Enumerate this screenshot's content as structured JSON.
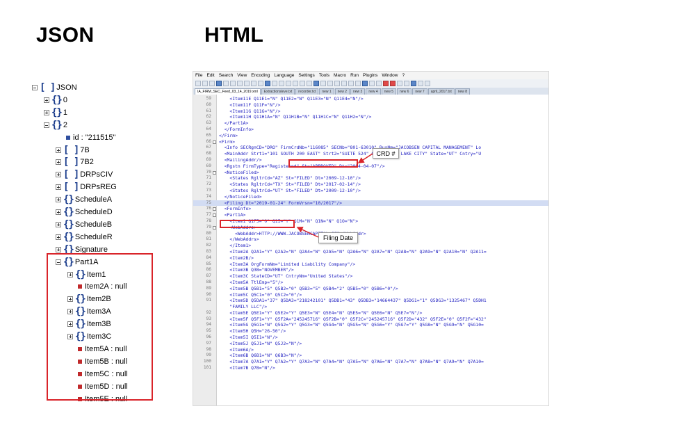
{
  "headings": {
    "left": "JSON",
    "right": "HTML"
  },
  "tree": [
    {
      "label": "JSON",
      "icon": "array",
      "level": 0,
      "expander": "minus"
    },
    {
      "label": "0",
      "icon": "object",
      "level": 1,
      "expander": "plus"
    },
    {
      "label": "1",
      "icon": "object",
      "level": 1,
      "expander": "plus"
    },
    {
      "label": "2",
      "icon": "object",
      "level": 1,
      "expander": "minus"
    },
    {
      "label": "id : \"211515\"",
      "icon": "leaf-blue",
      "level": 2,
      "expander": "none"
    },
    {
      "label": "7B",
      "icon": "array",
      "level": 2,
      "expander": "plus"
    },
    {
      "label": "7B2",
      "icon": "array",
      "level": 2,
      "expander": "plus"
    },
    {
      "label": "DRPsCIV",
      "icon": "array",
      "level": 2,
      "expander": "plus"
    },
    {
      "label": "DRPsREG",
      "icon": "array",
      "level": 2,
      "expander": "plus"
    },
    {
      "label": "ScheduleA",
      "icon": "object",
      "level": 2,
      "expander": "plus"
    },
    {
      "label": "ScheduleD",
      "icon": "object",
      "level": 2,
      "expander": "plus"
    },
    {
      "label": "ScheduleB",
      "icon": "object",
      "level": 2,
      "expander": "plus"
    },
    {
      "label": "ScheduleR",
      "icon": "object",
      "level": 2,
      "expander": "plus"
    },
    {
      "label": "Signature",
      "icon": "object",
      "level": 2,
      "expander": "plus"
    },
    {
      "label": "Part1A",
      "icon": "object",
      "level": 2,
      "expander": "minus"
    },
    {
      "label": "Item1",
      "icon": "object",
      "level": 3,
      "expander": "plus"
    },
    {
      "label": "Item2A : null",
      "icon": "leaf-red",
      "level": 3,
      "expander": "none"
    },
    {
      "label": "Item2B",
      "icon": "object",
      "level": 3,
      "expander": "plus"
    },
    {
      "label": "Item3A",
      "icon": "object",
      "level": 3,
      "expander": "plus"
    },
    {
      "label": "Item3B",
      "icon": "object",
      "level": 3,
      "expander": "plus"
    },
    {
      "label": "Item3C",
      "icon": "object",
      "level": 3,
      "expander": "plus"
    },
    {
      "label": "Item5A : null",
      "icon": "leaf-red",
      "level": 3,
      "expander": "none"
    },
    {
      "label": "Item5B : null",
      "icon": "leaf-red",
      "level": 3,
      "expander": "none"
    },
    {
      "label": "Item5C : null",
      "icon": "leaf-red",
      "level": 3,
      "expander": "none"
    },
    {
      "label": "Item5D : null",
      "icon": "leaf-red",
      "level": 3,
      "expander": "none"
    },
    {
      "label": "Item5E : null",
      "icon": "leaf-red",
      "level": 3,
      "expander": "none"
    }
  ],
  "editor": {
    "menu": [
      "File",
      "Edit",
      "Search",
      "View",
      "Encoding",
      "Language",
      "Settings",
      "Tools",
      "Macro",
      "Run",
      "Plugins",
      "Window",
      "?"
    ],
    "tabs": [
      "IA_FIRM_SEC_Feed_03_14_2019.xml",
      "Extractionsleve.txt",
      "recorder.txt",
      "new 1",
      "new 2",
      "new 3",
      "new 4",
      "new 5",
      "new 6",
      "new 7",
      "april_2017.txt",
      "new 8"
    ],
    "lines": [
      {
        "n": "59",
        "t": "    <Item11E Q11E1=\"N\" Q11E2=\"N\" Q11E3=\"N\" Q11E4=\"N\"/>"
      },
      {
        "n": "60",
        "t": "    <Item11F Q11F=\"N\"/>"
      },
      {
        "n": "61",
        "t": "    <Item11G Q11G=\"N\"/>"
      },
      {
        "n": "62",
        "t": "    <Item11H Q11H1A=\"N\" Q11H1B=\"N\" Q11H1C=\"N\" Q11H2=\"N\"/>"
      },
      {
        "n": "63",
        "t": "  </Part1A>"
      },
      {
        "n": "64",
        "t": "  </FormInfo>"
      },
      {
        "n": "65",
        "t": "</Firm>"
      },
      {
        "n": "66",
        "t": "<Firm>",
        "fold": true
      },
      {
        "n": "67",
        "t": "  <Info SECRgnCD=\"DRO\" FirmCrdNb=\"116085\" SECNb=\"801-63010\" BusNm=\"JACOBSEN CAPITAL MANAGEMENT\" Lo"
      },
      {
        "n": "68",
        "t": "  <MainAddr Strt1=\"101 SOUTH 200 EAST\" Strt2=\"SUITE 524\" City=\"SALT LAKE CITY\" State=\"UT\" Cntry=\"U"
      },
      {
        "n": "69",
        "t": "  <MailingAddr/>"
      },
      {
        "n": "69",
        "t": "  <Rgstn FirmType=\"Registered\" St=\"APPROVED\" Dt=\"2004-04-07\"/>"
      },
      {
        "n": "70",
        "t": "  <NoticeFiled>",
        "fold": true
      },
      {
        "n": "71",
        "t": "    <States RgltrCd=\"AZ\" St=\"FILED\" Dt=\"2009-12-10\"/>"
      },
      {
        "n": "72",
        "t": "    <States RgltrCd=\"TX\" St=\"FILED\" Dt=\"2017-02-14\"/>"
      },
      {
        "n": "73",
        "t": "    <States RgltrCd=\"UT\" St=\"FILED\" Dt=\"2009-12-10\"/>"
      },
      {
        "n": "74",
        "t": "  </NoticeFiled>"
      },
      {
        "n": "75",
        "t": "  <Filing Dt=\"2019-01-24\" FormVrsn=\"10/2017\"/>",
        "sel": true
      },
      {
        "n": "76",
        "t": "  <FormInfo>",
        "fold": true
      },
      {
        "n": "77",
        "t": "  <Part1A>",
        "fold": true
      },
      {
        "n": "78",
        "t": "    <Item1 Q1F5=\"0\" Q1I=\"Y\" Q1M=\"N\" Q1N=\"N\" Q1O=\"N\">"
      },
      {
        "n": "79",
        "t": "    <WebAddrs>",
        "fold": true
      },
      {
        "n": "80",
        "t": "      <WebAddr>HTTP://WWW.JACOBSENCAPITAL.COM</WebAddr>"
      },
      {
        "n": "81",
        "t": "    </WebAddrs>"
      },
      {
        "n": "82",
        "t": "    </Item1>"
      },
      {
        "n": "83",
        "t": "    <Item2A Q2A1=\"Y\" Q2A2=\"N\" Q2A4=\"N\" Q2A5=\"N\" Q2A6=\"N\" Q2A7=\"N\" Q2A8=\"N\" Q2A9=\"N\" Q2A10=\"N\" Q2A11="
      },
      {
        "n": "84",
        "t": "    <Item2B/>"
      },
      {
        "n": "85",
        "t": "    <Item3A OrgFormNm=\"Limited Liability Company\"/>"
      },
      {
        "n": "86",
        "t": "    <Item3B Q3B=\"NOVEMBER\"/>"
      },
      {
        "n": "87",
        "t": "    <Item3C StateCD=\"UT\" CntryNm=\"United States\"/>"
      },
      {
        "n": "88",
        "t": "    <Item5A TtlEmp=\"5\"/>"
      },
      {
        "n": "89",
        "t": "    <Item5B Q5B1=\"5\" Q5B2=\"0\" Q5B3=\"5\" Q5B4=\"2\" Q5B5=\"0\" Q5B6=\"0\"/>"
      },
      {
        "n": "90",
        "t": "    <Item5C Q5C1=\"0\" Q5C2=\"0\"/>"
      },
      {
        "n": "91",
        "t": "    <Item5D Q5DA1=\"37\" Q5DA3=\"218242101\" Q5DB1=\"43\" Q5DB3=\"14664437\" Q5DG1=\"1\" Q5DG3=\"1325467\" Q5DH1"
      },
      {
        "n": "",
        "t": "    \"FAMILY LLC\"/>"
      },
      {
        "n": "92",
        "t": "    <Item5E Q5E1=\"Y\" Q5E2=\"Y\" Q5E3=\"N\" Q5E4=\"N\" Q5E5=\"N\" Q5E6=\"N\" Q5E7=\"N\"/>"
      },
      {
        "n": "93",
        "t": "    <Item5F Q5F1=\"Y\" Q5F2A=\"245245716\" Q5F2B=\"0\" Q5F2C=\"245245716\" Q5F2D=\"432\" Q5F2E=\"0\" Q5F2F=\"432\""
      },
      {
        "n": "94",
        "t": "    <Item5G Q5G1=\"N\" Q5G2=\"Y\" Q5G3=\"N\" Q5G4=\"N\" Q5G5=\"N\" Q5G6=\"Y\" Q5G7=\"Y\" Q5G8=\"N\" Q5G9=\"N\" Q5G10="
      },
      {
        "n": "95",
        "t": "    <Item5H Q5H=\"26-50\"/>"
      },
      {
        "n": "96",
        "t": "    <Item5I Q5I1=\"N\"/>"
      },
      {
        "n": "97",
        "t": "    <Item5J Q5J1=\"N\" Q5J2=\"N\"/>"
      },
      {
        "n": "98",
        "t": "    <Item6A/>"
      },
      {
        "n": "99",
        "t": "    <Item6B Q6B1=\"N\" Q6B3=\"N\"/>"
      },
      {
        "n": "100",
        "t": "    <Item7A Q7A1=\"Y\" Q7A2=\"Y\" Q7A3=\"N\" Q7A4=\"N\" Q7A5=\"N\" Q7A6=\"N\" Q7A7=\"N\" Q7A8=\"N\" Q7A9=\"N\" Q7A10="
      },
      {
        "n": "101",
        "t": "    <Item7B Q7B=\"N\"/>"
      }
    ]
  },
  "callouts": {
    "crd": "CRD #",
    "filing": "Filing Date"
  },
  "colors": {
    "highlight": "#d9242a",
    "tree_icon": "#1a3c8c",
    "xml_tag": "#1d1dc0",
    "selection": "#d2dcf3"
  }
}
